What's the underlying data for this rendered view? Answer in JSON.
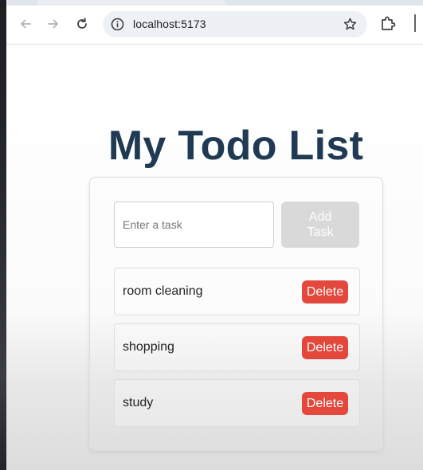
{
  "browser": {
    "url": "localhost:5173",
    "icons": [
      "back-arrow-icon",
      "forward-arrow-icon",
      "reload-icon",
      "site-info-icon",
      "bookmark-star-icon",
      "extensions-puzzle-icon"
    ]
  },
  "app": {
    "title": "My Todo List",
    "input": {
      "placeholder": "Enter a task",
      "value": ""
    },
    "add_button_label": "Add Task",
    "delete_label": "Delete",
    "tasks": [
      {
        "text": "room cleaning"
      },
      {
        "text": "shopping"
      },
      {
        "text": "study"
      }
    ]
  },
  "colors": {
    "title": "#1f3a52",
    "delete": "#e4473c",
    "add_disabled": "#d9d9d9"
  }
}
